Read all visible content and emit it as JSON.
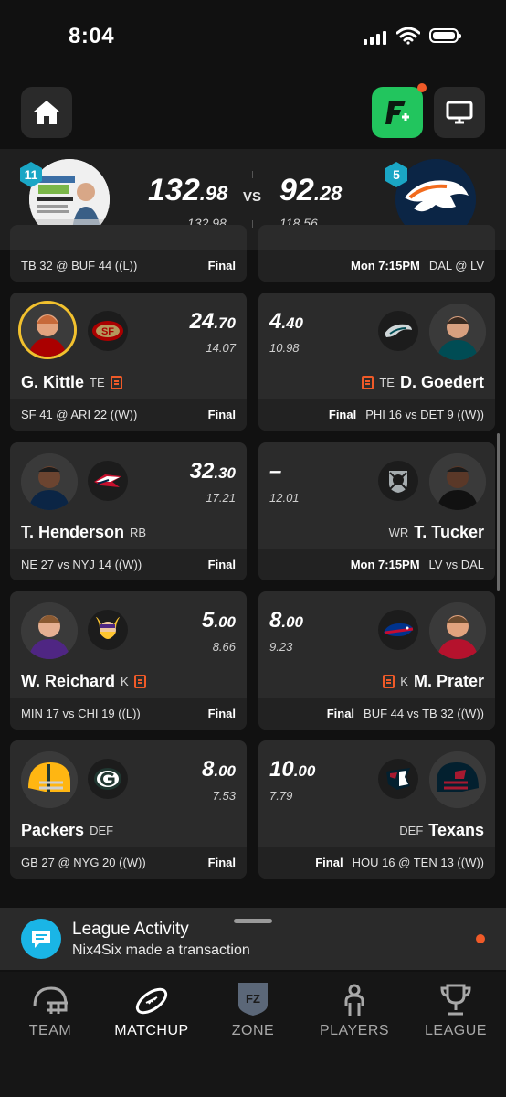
{
  "status": {
    "time": "8:04"
  },
  "header": {
    "icons": [
      "home-icon",
      "fantasy-plus-icon",
      "tv-icon"
    ]
  },
  "matchup": {
    "my_team": {
      "rank": "11",
      "score_int": "132",
      "score_dec": ".98",
      "projected": "132.98"
    },
    "opponent": {
      "rank": "5",
      "score_int": "92",
      "score_dec": ".28",
      "projected": "118.56"
    },
    "vs": "VS"
  },
  "prev_row": {
    "left_game": "TB 32 @ BUF 44 ((L))",
    "left_status": "Final",
    "right_status": "Mon 7:15PM",
    "right_game": "DAL @ LV"
  },
  "rows": [
    {
      "left": {
        "name": "G. Kittle",
        "pos": "TE",
        "pts_int": "24",
        "pts_dec": ".70",
        "proj": "14.07",
        "game": "SF 41 @ ARI 22 ((W))",
        "status": "Final",
        "team_logo": "49ers-logo"
      },
      "right": {
        "name": "D. Goedert",
        "pos": "TE",
        "pts_int": "4",
        "pts_dec": ".40",
        "proj": "10.98",
        "game": "PHI 16 vs DET 9 ((W))",
        "status": "Final",
        "team_logo": "eagles-logo"
      }
    },
    {
      "left": {
        "name": "T. Henderson",
        "pos": "RB",
        "pts_int": "32",
        "pts_dec": ".30",
        "proj": "17.21",
        "game": "NE 27 vs NYJ 14 ((W))",
        "status": "Final",
        "team_logo": "patriots-logo"
      },
      "right": {
        "name": "T. Tucker",
        "pos": "WR",
        "pts_int": "–",
        "pts_dec": "",
        "proj": "12.01",
        "game": "LV vs DAL",
        "status": "Mon 7:15PM",
        "team_logo": "raiders-logo"
      }
    },
    {
      "left": {
        "name": "W. Reichard",
        "pos": "K",
        "pts_int": "5",
        "pts_dec": ".00",
        "proj": "8.66",
        "game": "MIN 17 vs CHI 19 ((L))",
        "status": "Final",
        "team_logo": "vikings-logo"
      },
      "right": {
        "name": "M. Prater",
        "pos": "K",
        "pts_int": "8",
        "pts_dec": ".00",
        "proj": "9.23",
        "game": "BUF 44 vs TB 32 ((W))",
        "status": "Final",
        "team_logo": "bills-logo"
      }
    },
    {
      "left": {
        "name": "Packers",
        "pos": "DEF",
        "pts_int": "8",
        "pts_dec": ".00",
        "proj": "7.53",
        "game": "GB 27 @ NYG 20 ((W))",
        "status": "Final",
        "team_logo": "packers-logo"
      },
      "right": {
        "name": "Texans",
        "pos": "DEF",
        "pts_int": "10",
        "pts_dec": ".00",
        "proj": "7.79",
        "game": "HOU 16 @ TEN 13 ((W))",
        "status": "Final",
        "team_logo": "texans-logo"
      }
    }
  ],
  "activity": {
    "title": "League Activity",
    "subtitle": "Nix4Six made a transaction"
  },
  "tabs": [
    {
      "label": "TEAM",
      "icon": "helmet-icon"
    },
    {
      "label": "MATCHUP",
      "icon": "football-icon"
    },
    {
      "label": "ZONE",
      "icon": "fz-shield-icon",
      "badge": "FZ"
    },
    {
      "label": "PLAYERS",
      "icon": "player-icon"
    },
    {
      "label": "LEAGUE",
      "icon": "trophy-icon"
    }
  ],
  "colors": {
    "accent": "#f05a28",
    "green": "#22c55e",
    "rank_badge": "#1aa6c5",
    "activity_icon": "#1ab5e6"
  }
}
